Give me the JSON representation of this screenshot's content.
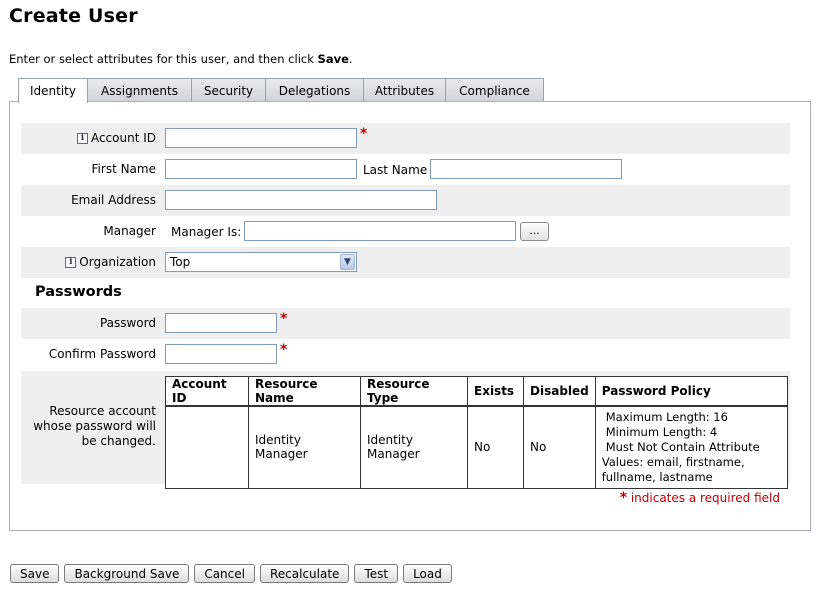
{
  "page": {
    "title": "Create User",
    "instructions_prefix": "Enter or select attributes for this user, and then click ",
    "instructions_action": "Save",
    "instructions_suffix": "."
  },
  "tabs": [
    {
      "label": "Identity",
      "active": true
    },
    {
      "label": "Assignments",
      "active": false
    },
    {
      "label": "Security",
      "active": false
    },
    {
      "label": "Delegations",
      "active": false
    },
    {
      "label": "Attributes",
      "active": false
    },
    {
      "label": "Compliance",
      "active": false
    }
  ],
  "form": {
    "info_icon_glyph": "i",
    "account_id": {
      "label": "Account ID",
      "value": "",
      "required": "*"
    },
    "first_name": {
      "label": "First Name",
      "value": ""
    },
    "last_name": {
      "label": "Last Name",
      "value": ""
    },
    "email": {
      "label": "Email Address",
      "value": ""
    },
    "manager": {
      "label": "Manager",
      "sub_label": "Manager Is:",
      "value": "",
      "browse_label": "..."
    },
    "organization": {
      "label": "Organization",
      "selected": "Top"
    }
  },
  "passwords": {
    "heading": "Passwords",
    "password": {
      "label": "Password",
      "value": "",
      "required": "*"
    },
    "confirm": {
      "label": "Confirm Password",
      "value": "",
      "required": "*"
    },
    "resource_label": "Resource account whose password will be changed.",
    "table": {
      "headers": [
        "Account ID",
        "Resource Name",
        "Resource Type",
        "Exists",
        "Disabled",
        "Password Policy"
      ],
      "rows": [
        {
          "account_id": "",
          "resource_name": "Identity Manager",
          "resource_type": "Identity Manager",
          "exists": "No",
          "disabled": "No",
          "policy_line1": "Maximum Length: 16",
          "policy_line2": "Minimum Length: 4",
          "policy_line3": "Must Not Contain Attribute",
          "policy_line4": "Values: email, firstname,",
          "policy_line5": "fullname, lastname"
        }
      ]
    }
  },
  "required_note": {
    "star": "*",
    "text": "indicates a required field"
  },
  "buttons": {
    "save": "Save",
    "background_save": "Background Save",
    "cancel": "Cancel",
    "recalculate": "Recalculate",
    "test": "Test",
    "load": "Load"
  },
  "colors": {
    "required": "#c00000",
    "row_shade": "#efefef",
    "input_border": "#7f9db9"
  }
}
